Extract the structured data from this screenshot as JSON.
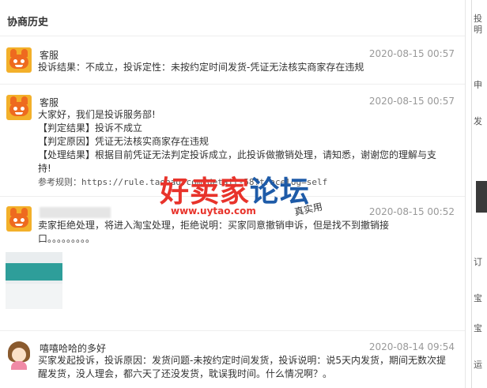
{
  "section_title": "协商历史",
  "messages": [
    {
      "sender": "客服",
      "time": "2020-08-15 00:57",
      "lines": [
        "投诉结果：不成立，投诉定性：未按约定时间发货-凭证无法核实商家存在违规"
      ]
    },
    {
      "sender": "客服",
      "time": "2020-08-15 00:57",
      "lines": [
        "大家好，我们是投诉服务部!",
        "【判定结果】投诉不成立",
        "【判定原因】凭证无法核实商家存在违规",
        "【处理结果】根据目前凭证无法判定投诉成立，此投诉做撤销处理，请知悉，谢谢您的理解与支",
        "持!",
        "参考规则：https://rule.taobao.com/detail-58?tracelog=self"
      ]
    },
    {
      "sender": "",
      "time": "2020-08-15 00:52",
      "lines": [
        "卖家拒绝处理，将进入淘宝处理，拒绝说明：买家同意撤销申诉，但是找不到撤销接",
        "口。。。。。。。。。"
      ]
    },
    {
      "sender": "嘻嘻哈哈的多好",
      "time": "2020-08-14 09:54",
      "lines": [
        "买家发起投诉，投诉原因：发货问题-未按约定时间发货，投诉说明：说5天内发货，期间无数次提",
        "醒发货，没人理会，都六天了还没发货，耽误我时间。什么情况啊？。"
      ]
    }
  ],
  "watermark": {
    "main_red": "好卖家",
    "main_blue": "论坛",
    "url": "www.uytao.com",
    "tag": "真实用"
  },
  "right_strip": [
    "投",
    "明",
    "申",
    "发",
    "订",
    "宝",
    "宝",
    "运"
  ]
}
